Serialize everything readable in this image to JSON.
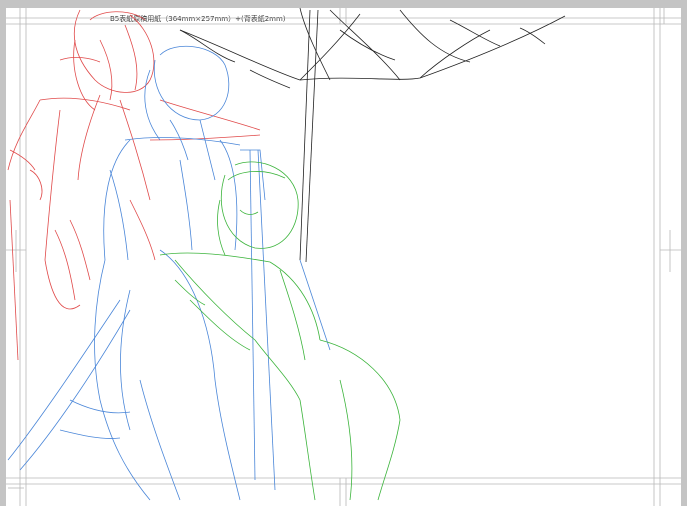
{
  "canvas": {
    "paper_label": "B5表紙原稿用紙（364mm×257mm）+(背表紙2mm)"
  },
  "colors": {
    "background": "#c4c4c4",
    "paper": "#ffffff",
    "guide": "#b8b8b8",
    "red_layer": "#e04a4a",
    "blue_layer": "#4a86d8",
    "green_layer": "#3cb43c",
    "ink_layer": "#222222"
  },
  "layers": [
    {
      "name": "red-sketch-layer",
      "color": "#e04a4a"
    },
    {
      "name": "blue-sketch-layer",
      "color": "#4a86d8"
    },
    {
      "name": "green-sketch-layer",
      "color": "#3cb43c"
    },
    {
      "name": "umbrella-ink-layer",
      "color": "#222222"
    }
  ]
}
